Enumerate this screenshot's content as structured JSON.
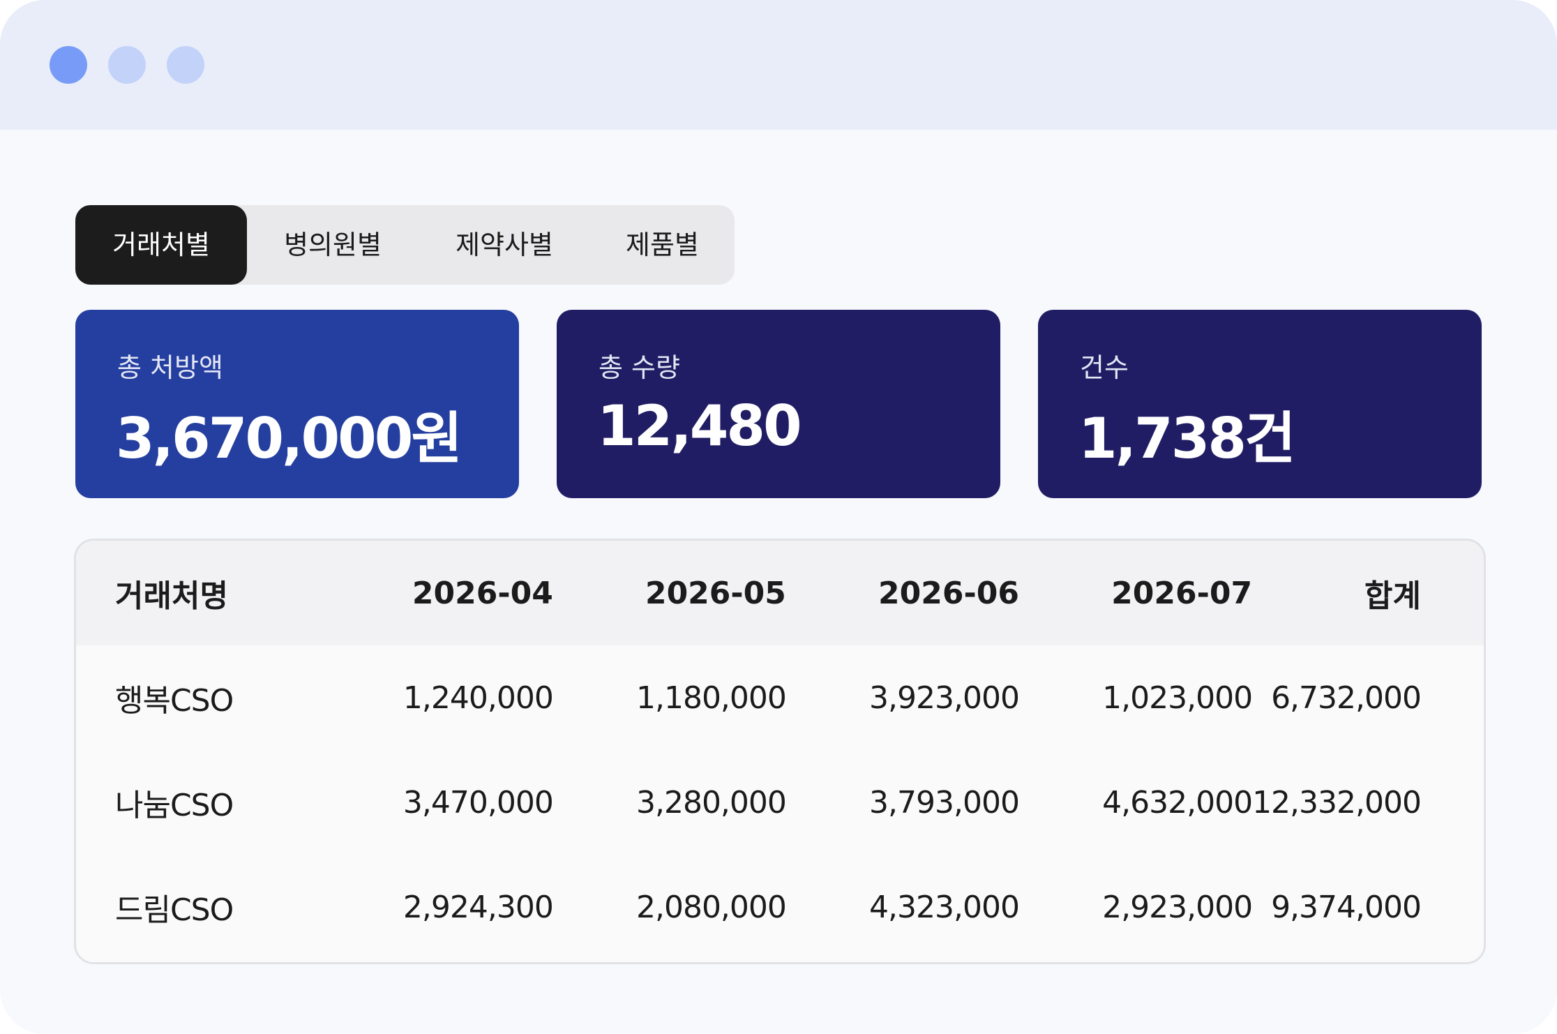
{
  "window": {
    "controls": [
      "close",
      "minimize",
      "maximize"
    ],
    "colors": {
      "titlebar": "#e9edf9",
      "dot_active": "#779bf6",
      "dot_inactive": "#c2d2f9"
    }
  },
  "tabs": [
    {
      "label": "거래처별",
      "active": true
    },
    {
      "label": "병의원별",
      "active": false
    },
    {
      "label": "제약사별",
      "active": false
    },
    {
      "label": "제품별",
      "active": false
    }
  ],
  "summary": {
    "total_amount": {
      "label": "총 처방액",
      "value": "3,670,000원",
      "color": "#243f9f"
    },
    "total_quantity": {
      "label": "총 수량",
      "value": "12,480",
      "color": "#211d64"
    },
    "count": {
      "label": "건수",
      "value": "1,738건",
      "color": "#211d64"
    }
  },
  "table": {
    "headers": [
      "거래처명",
      "2026-04",
      "2026-05",
      "2026-06",
      "2026-07",
      "합계"
    ],
    "rows": [
      [
        "행복CSO",
        "1,240,000",
        "1,180,000",
        "3,923,000",
        "1,023,000",
        "6,732,000"
      ],
      [
        "나눔CSO",
        "3,470,000",
        "3,280,000",
        "3,793,000",
        "4,632,000",
        "12,332,000"
      ],
      [
        "드림CSO",
        "2,924,300",
        "2,080,000",
        "4,323,000",
        "2,923,000",
        "9,374,000"
      ]
    ]
  }
}
